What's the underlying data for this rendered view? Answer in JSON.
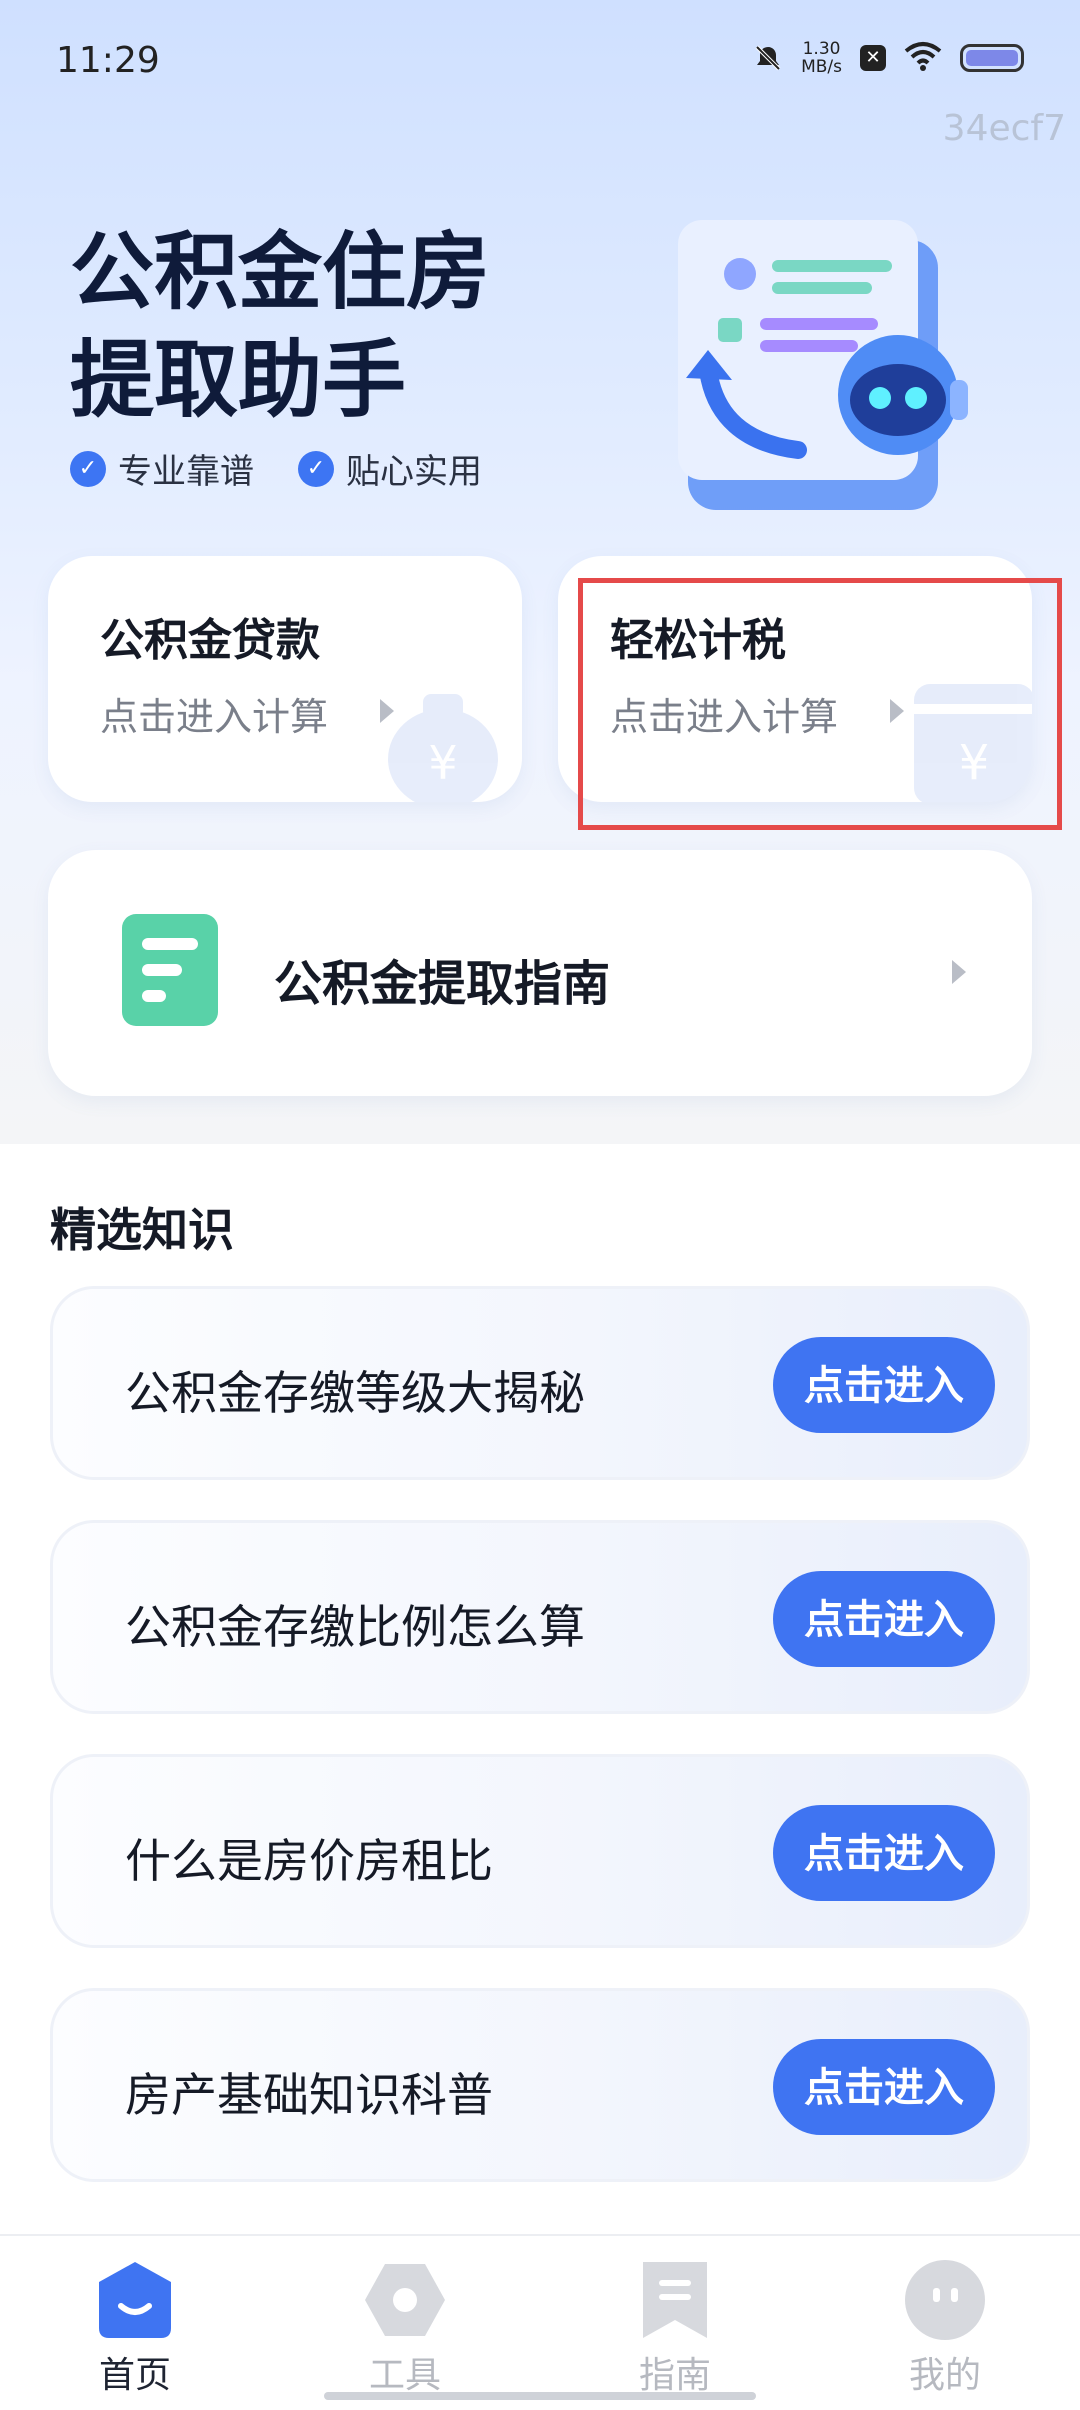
{
  "status_bar": {
    "time": "11:29",
    "net_speed": "1.30",
    "net_unit": "MB/s"
  },
  "watermark": "34ecf7",
  "hero": {
    "title_line1": "公积金住房",
    "title_line2": "提取助手",
    "tags": [
      "专业靠谱",
      "贴心实用"
    ]
  },
  "cards": [
    {
      "title": "公积金贷款",
      "subtitle": "点击进入计算"
    },
    {
      "title": "轻松计税",
      "subtitle": "点击进入计算"
    }
  ],
  "guide": {
    "label": "公积金提取指南"
  },
  "knowledge": {
    "title": "精选知识",
    "items": [
      {
        "label": "公积金存缴等级大揭秘",
        "button": "点击进入"
      },
      {
        "label": "公积金存缴比例怎么算",
        "button": "点击进入"
      },
      {
        "label": "什么是房价房租比",
        "button": "点击进入"
      },
      {
        "label": "房产基础知识科普",
        "button": "点击进入"
      }
    ]
  },
  "tabbar": {
    "items": [
      {
        "label": "首页",
        "icon": "home-icon"
      },
      {
        "label": "工具",
        "icon": "tools-icon"
      },
      {
        "label": "指南",
        "icon": "guide-icon"
      },
      {
        "label": "我的",
        "icon": "profile-icon"
      }
    ],
    "active": "首页"
  },
  "colors": {
    "accent": "#3f74f2",
    "highlight_box": "#e54a4a",
    "guide_icon": "#59d2a8"
  }
}
